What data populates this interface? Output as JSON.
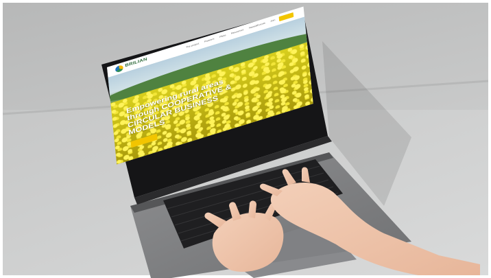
{
  "site": {
    "logo_text": "BRILIAN",
    "menu": [
      "The project",
      "Partners",
      "Pilots",
      "Resources",
      "News&Events",
      "Join"
    ],
    "headline_line1": "Empowering rural areas",
    "headline_line2": "through COOPERATIVE &",
    "headline_line3": "CIRCULAR BUSINESS",
    "headline_line4": "MODELS",
    "colors": {
      "accent": "#f2c500",
      "brand_green": "#2e6b3a",
      "field_yellow": "#e5da25"
    }
  }
}
